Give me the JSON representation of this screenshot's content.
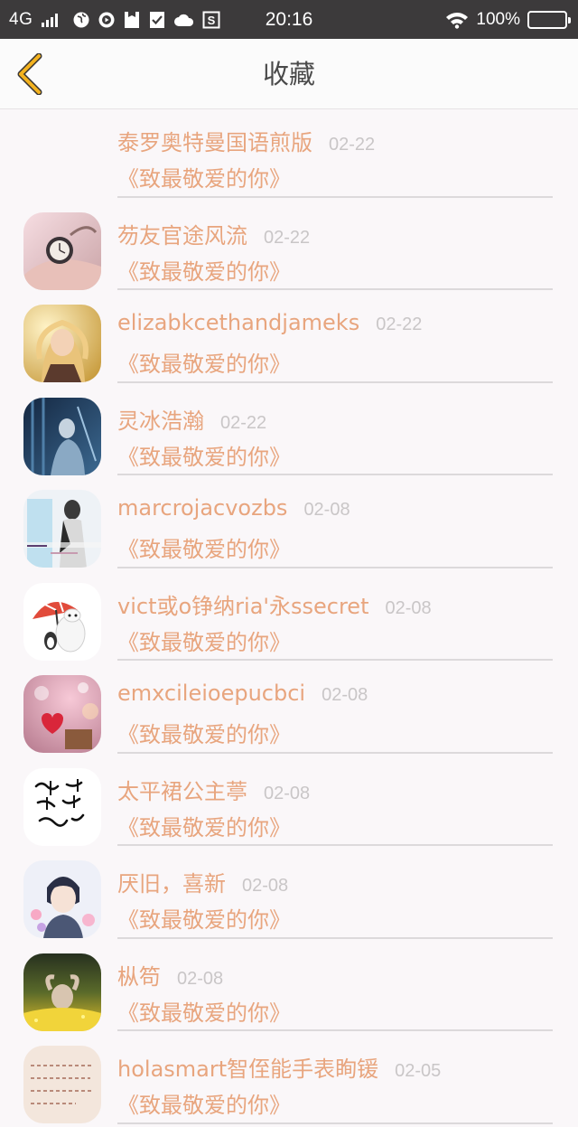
{
  "status_bar": {
    "network": "4G",
    "time": "20:16",
    "battery": "100%",
    "battery_level": 1.0,
    "icons": [
      "signal-icon",
      "globe-icon",
      "play-icon",
      "save-icon",
      "check-icon",
      "cloud-icon",
      "s-icon",
      "wifi-icon",
      "battery-icon"
    ]
  },
  "nav": {
    "title": "收藏",
    "back_icon": "chevron-left-icon",
    "accent": "#f3b21f"
  },
  "colors": {
    "name": "#e8a57e",
    "date": "#c9c6c7",
    "status_bar_bg": "#3c3a3b"
  },
  "items": [
    {
      "name": "泰罗奥特曼国语煎版",
      "date": "02-22",
      "book": "《致最敬爱的你》",
      "avatar": "none"
    },
    {
      "name": "芴友官途风流",
      "date": "02-22",
      "book": "《致最敬爱的你》",
      "avatar": "pocket-watch-photo"
    },
    {
      "name": "elizabkcethandjameks",
      "date": "02-22",
      "book": "《致最敬爱的你》",
      "avatar": "girl-photo"
    },
    {
      "name": "灵冰浩瀚",
      "date": "02-22",
      "book": "《致最敬爱的你》",
      "avatar": "blue-figure-photo"
    },
    {
      "name": "marcrojacvozbs",
      "date": "02-08",
      "book": "《致最敬爱的你》",
      "avatar": "woman-text-photo"
    },
    {
      "name": "vict或o铮纳ria'永ssecret",
      "date": "02-08",
      "book": "《致最敬爱的你》",
      "avatar": "baymax-umbrella-image"
    },
    {
      "name": "emxcileioepucbci",
      "date": "02-08",
      "book": "《致最敬爱的你》",
      "avatar": "heart-bokeh-photo"
    },
    {
      "name": "太平裙公主葶",
      "date": "02-08",
      "book": "《致最敬爱的你》",
      "avatar": "calligraphy-image"
    },
    {
      "name": "厌旧，喜新",
      "date": "02-08",
      "book": "《致最敬爱的你》",
      "avatar": "anime-boy-image"
    },
    {
      "name": "枞笱",
      "date": "02-08",
      "book": "《致最敬爱的你》",
      "avatar": "flower-field-photo"
    },
    {
      "name": "holasmart智侄能手表眴锾",
      "date": "02-05",
      "book": "《致最敬爱的你》",
      "avatar": "handwritten-note-image"
    }
  ]
}
